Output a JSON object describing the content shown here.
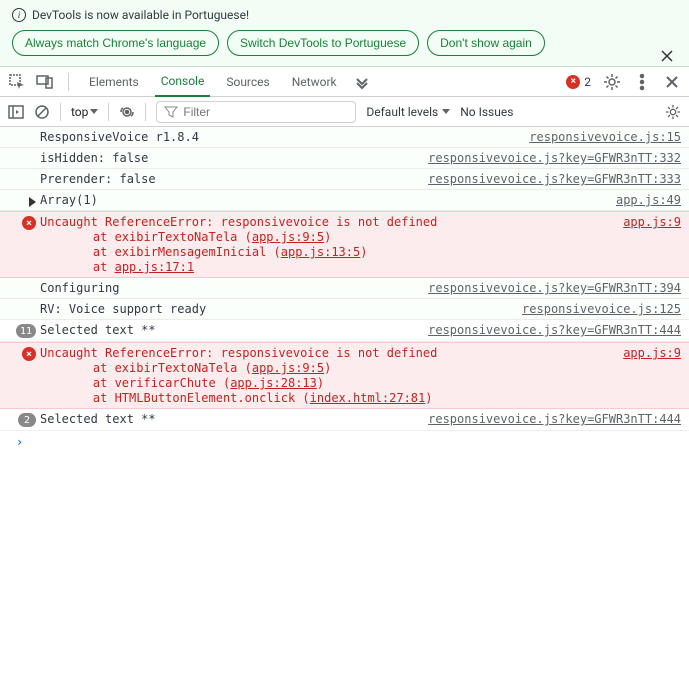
{
  "banner": {
    "title": "DevTools is now available in Portuguese!",
    "btn_match": "Always match Chrome's language",
    "btn_switch": "Switch DevTools to Portuguese",
    "btn_dismiss": "Don't show again"
  },
  "tabs": {
    "elements": "Elements",
    "console": "Console",
    "sources": "Sources",
    "network": "Network",
    "error_count": "2"
  },
  "toolbar": {
    "context": "top",
    "filter_placeholder": "Filter",
    "levels": "Default levels",
    "issues": "No Issues"
  },
  "logs": {
    "l0": {
      "msg": "ResponsiveVoice r1.8.4",
      "src": "responsivevoice.js:15"
    },
    "l1": {
      "msg": "isHidden: false",
      "src": "responsivevoice.js?key=GFWR3nTT:332"
    },
    "l2": {
      "msg": "Prerender: false",
      "src": "responsivevoice.js?key=GFWR3nTT:333"
    },
    "l3": {
      "msg": "Array(1)",
      "src": "app.js:49"
    },
    "e1": {
      "title": "Uncaught ReferenceError: responsivevoice is not defined",
      "src": "app.js:9",
      "s0a": "    at exibirTextoNaTela (",
      "s0b": "app.js:9:5",
      "s0c": ")",
      "s1a": "    at exibirMensagemInicial (",
      "s1b": "app.js:13:5",
      "s1c": ")",
      "s2a": "    at ",
      "s2b": "app.js:17:1"
    },
    "l4": {
      "msg": "Configuring",
      "src": "responsivevoice.js?key=GFWR3nTT:394"
    },
    "l5": {
      "msg": "RV: Voice support ready",
      "src": "responsivevoice.js:125"
    },
    "l6": {
      "count": "11",
      "msg": "Selected text **",
      "src": "responsivevoice.js?key=GFWR3nTT:444"
    },
    "e2": {
      "title": "Uncaught ReferenceError: responsivevoice is not defined",
      "src": "app.js:9",
      "s0a": "    at exibirTextoNaTela (",
      "s0b": "app.js:9:5",
      "s0c": ")",
      "s1a": "    at verificarChute (",
      "s1b": "app.js:28:13",
      "s1c": ")",
      "s2a": "    at HTMLButtonElement.onclick (",
      "s2b": "index.html:27:81",
      "s2c": ")"
    },
    "l7": {
      "count": "2",
      "msg": "Selected text **",
      "src": "responsivevoice.js?key=GFWR3nTT:444"
    }
  }
}
